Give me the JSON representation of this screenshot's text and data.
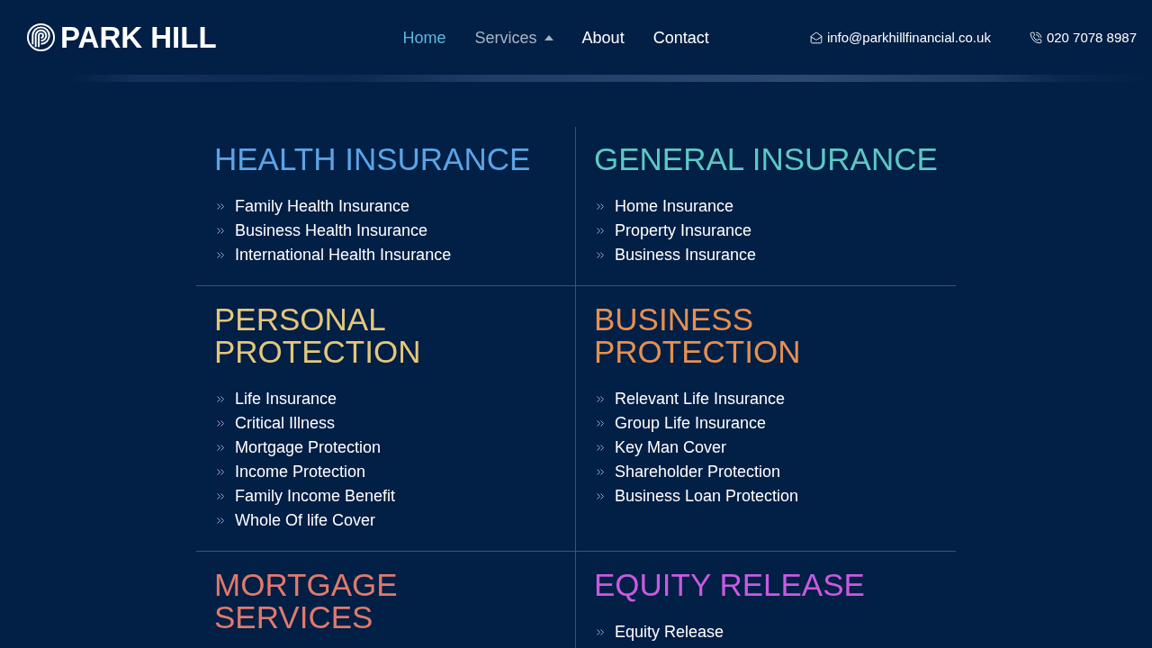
{
  "header": {
    "logo": {
      "text": "PARK HILL"
    },
    "nav": [
      {
        "label": "Home",
        "kind": "link",
        "selected": true,
        "hovered": false
      },
      {
        "label": "Services",
        "kind": "dropdown",
        "selected": false,
        "hovered": true
      },
      {
        "label": "About",
        "kind": "link",
        "selected": false,
        "hovered": false
      },
      {
        "label": "Contact",
        "kind": "link",
        "selected": false,
        "hovered": false
      }
    ],
    "contacts": [
      {
        "kind": "email",
        "text": "info@parkhillfinancial.co.uk"
      },
      {
        "kind": "phone",
        "text": "020 7078 8987"
      }
    ]
  },
  "services": [
    {
      "title": "HEALTH INSURANCE",
      "color": "#5ba4e6",
      "items": [
        "Family Health Insurance",
        "Business Health Insurance",
        "International Health Insurance"
      ]
    },
    {
      "title": "GENERAL INSURANCE",
      "color": "#5cc9c4",
      "items": [
        "Home Insurance",
        "Property Insurance",
        "Business Insurance"
      ]
    },
    {
      "title": "PERSONAL PROTECTION",
      "color": "#e3c77b",
      "items": [
        "Life Insurance",
        "Critical Illness",
        "Mortgage Protection",
        "Income Protection",
        "Family Income Benefit",
        "Whole Of life Cover"
      ]
    },
    {
      "title": "BUSINESS PROTECTION",
      "color": "#e69050",
      "items": [
        "Relevant Life Insurance",
        "Group Life Insurance",
        "Key Man Cover",
        "Shareholder Protection",
        "Business Loan Protection"
      ]
    },
    {
      "title": "MORTGAGE SERVICES",
      "color": "#e07a6c"
    },
    {
      "title": "EQUITY RELEASE",
      "color": "#c85ae0",
      "items": [
        "Equity Release"
      ]
    }
  ]
}
